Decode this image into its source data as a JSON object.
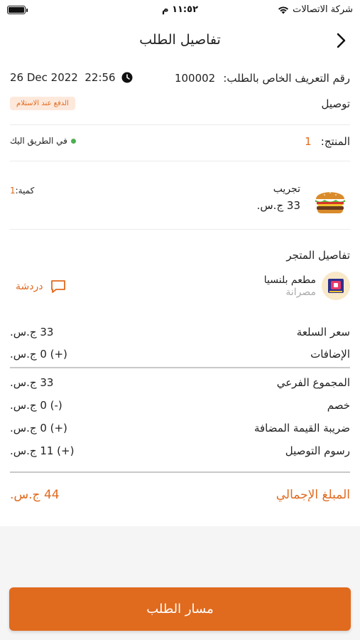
{
  "status": {
    "carrier": "شركة الاتصالات",
    "time": "١١:٥٢ م"
  },
  "header": {
    "title": "تفاصيل الطلب"
  },
  "order": {
    "id_label": "رقم التعريف الخاص بالطلب:",
    "id_value": "100002",
    "datetime": "26 Dec 2022  22:56",
    "delivery_type": "توصيل",
    "payment_badge": "الدفع عند الاستلام",
    "product_label": "المنتج:",
    "product_count": "1",
    "status": "في الطريق اليك"
  },
  "item": {
    "name": "تجريب",
    "price": "33 ج.س.",
    "qty_label": "كمية:",
    "qty_value": "1"
  },
  "store": {
    "section_title": "تفاصيل المتجر",
    "name": "مطعم بلنسيا",
    "subtitle": "مصرانة",
    "chat_label": "دردشة"
  },
  "summary": [
    {
      "label": "سعر السلعة",
      "value": "33 ج.س."
    },
    {
      "label": "الإضافات",
      "value": "(+) 0 ج.س."
    },
    {
      "label": "المجموع الفرعي",
      "value": "33 ج.س."
    },
    {
      "label": "خصم",
      "value": "(-) 0 ج.س."
    },
    {
      "label": "ضريبة القيمة المضافة",
      "value": "(+) 0 ج.س."
    },
    {
      "label": "رسوم التوصيل",
      "value": "(+) 11 ج.س."
    }
  ],
  "total": {
    "label": "المبلغ الإجمالي",
    "value": "44 ج.س."
  },
  "cta": {
    "label": "مسار الطلب"
  },
  "colors": {
    "accent": "#e06a1e",
    "status_dot": "#4caf50",
    "badge_bg": "#fde9dc"
  }
}
